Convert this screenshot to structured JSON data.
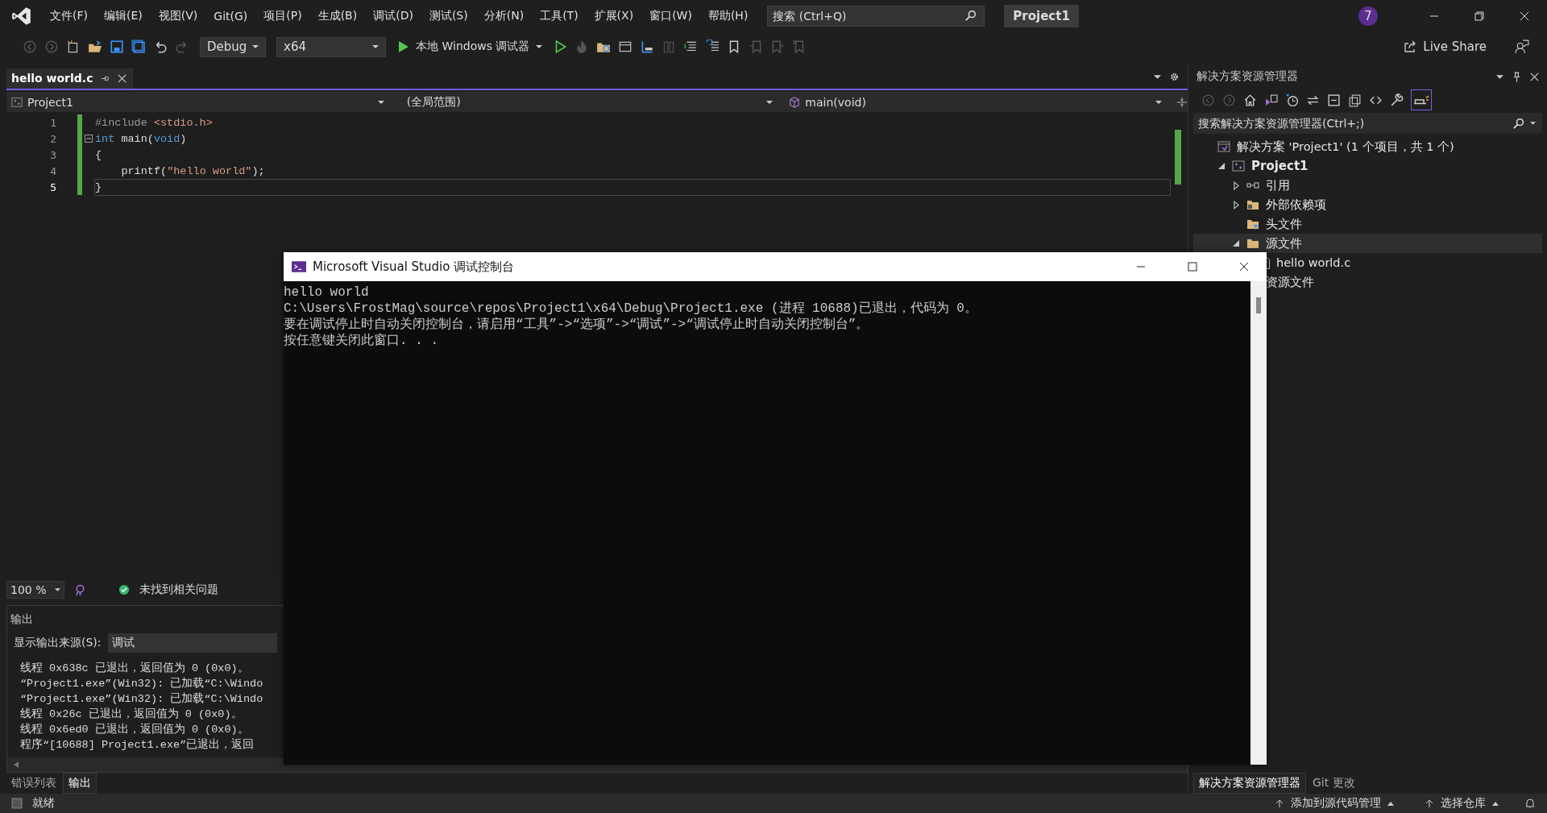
{
  "menu": [
    "文件(F)",
    "编辑(E)",
    "视图(V)",
    "Git(G)",
    "项目(P)",
    "生成(B)",
    "调试(D)",
    "测试(S)",
    "分析(N)",
    "工具(T)",
    "扩展(X)",
    "窗口(W)",
    "帮助(H)"
  ],
  "search": {
    "placeholder": "搜索 (Ctrl+Q)"
  },
  "project_name": "Project1",
  "account_badge": "7",
  "toolbar": {
    "configuration": "Debug",
    "platform": "x64",
    "run_button": "本地 Windows 调试器",
    "live_share": "Live Share"
  },
  "editor": {
    "tabs": [
      {
        "label": "hello world.c",
        "selected": true
      }
    ],
    "nav": [
      "Project1",
      "(全局范围)",
      "main(void)"
    ],
    "lines": [
      {
        "number": "1",
        "collapsible": false,
        "current": false,
        "tokens": [
          {
            "kind": "preproc",
            "text": "#include"
          },
          {
            "kind": "string",
            "text": " <stdio.h>"
          }
        ]
      },
      {
        "number": "2",
        "collapsible": true,
        "current": false,
        "tokens": [
          {
            "kind": "keyword",
            "text": "int"
          },
          {
            "kind": "plain",
            "text": " main("
          },
          {
            "kind": "keyword",
            "text": "void"
          },
          {
            "kind": "plain",
            "text": ")"
          }
        ]
      },
      {
        "number": "3",
        "collapsible": false,
        "current": false,
        "tokens": [
          {
            "kind": "plain",
            "text": "{"
          }
        ]
      },
      {
        "number": "4",
        "collapsible": false,
        "current": false,
        "tokens": [
          {
            "kind": "plain",
            "text": "    printf("
          },
          {
            "kind": "string",
            "text": "\"hello world\""
          },
          {
            "kind": "plain",
            "text": ");"
          }
        ]
      },
      {
        "number": "5",
        "collapsible": false,
        "current": true,
        "tokens": [
          {
            "kind": "plain",
            "text": "}"
          }
        ]
      }
    ],
    "zoom": "100 %",
    "issues": "未找到相关问题"
  },
  "output": {
    "title": "输出",
    "source_label": "显示输出来源(S):",
    "source": "调试",
    "lines": [
      "线程 0x638c 已退出，返回值为 0 (0x0)。",
      "“Project1.exe”(Win32): 已加载“C:\\Windo",
      "“Project1.exe”(Win32): 已加载“C:\\Windo",
      "线程 0x26c 已退出，返回值为 0 (0x0)。",
      "线程 0x6ed0 已退出，返回值为 0 (0x0)。",
      "程序“[10688] Project1.exe”已退出，返回"
    ]
  },
  "bottom_tabs": [
    {
      "label": "错误列表",
      "selected": false
    },
    {
      "label": "输出",
      "selected": true
    }
  ],
  "solution_explorer": {
    "title": "解决方案资源管理器",
    "search_placeholder": "搜索解决方案资源管理器(Ctrl+;)",
    "tree": [
      {
        "label": "解决方案 'Project1' (1 个项目，共 1 个)",
        "kind": "solution",
        "selected": false,
        "children": [
          {
            "label": "Project1",
            "kind": "project",
            "expanded": true,
            "selected": false,
            "children": [
              {
                "label": "引用",
                "kind": "references",
                "expanded": false,
                "selected": false
              },
              {
                "label": "外部依赖项",
                "kind": "external",
                "expanded": false,
                "selected": false
              },
              {
                "label": "头文件",
                "kind": "filter",
                "selected": false
              },
              {
                "label": "源文件",
                "kind": "folder",
                "expanded": true,
                "selected": true,
                "children": [
                  {
                    "label": "hello world.c",
                    "kind": "file",
                    "selected": false
                  }
                ]
              },
              {
                "label": "资源文件",
                "kind": "folder",
                "selected": false
              }
            ]
          }
        ]
      }
    ],
    "tabs": [
      {
        "label": "解决方案资源管理器",
        "selected": true
      },
      {
        "label": "Git 更改",
        "selected": false
      }
    ]
  },
  "console": {
    "title": "Microsoft Visual Studio 调试控制台",
    "lines": [
      "hello world",
      "C:\\Users\\FrostMag\\source\\repos\\Project1\\x64\\Debug\\Project1.exe (进程 10688)已退出，代码为 0。",
      "要在调试停止时自动关闭控制台，请启用“工具”->“选项”->“调试”->“调试停止时自动关闭控制台”。",
      "按任意键关闭此窗口. . ."
    ]
  },
  "status_bar": {
    "text": "就绪",
    "items": [
      "添加到源代码管理",
      "选择仓库"
    ]
  }
}
